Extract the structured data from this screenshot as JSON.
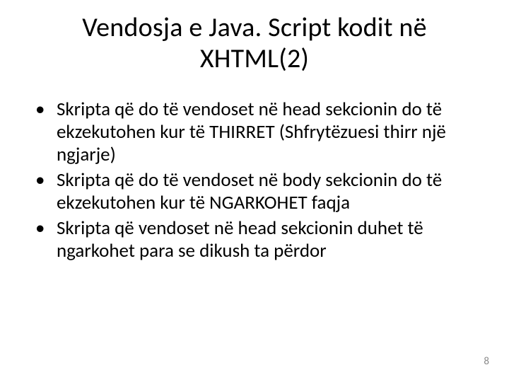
{
  "title_line1": "Vendosja e Java. Script kodit në",
  "title_line2": "XHTML(2)",
  "bullets": [
    "Skripta që do të vendoset në head sekcionin do të ekzekutohen kur të THIRRET (Shfrytëzuesi thirr një ngjarje)",
    "Skripta që do të vendoset në body sekcionin do të ekzekutohen kur të NGARKOHET faqja",
    "Skripta që vendoset në head sekcionin duhet të ngarkohet para se dikush ta përdor"
  ],
  "page_number": "8"
}
